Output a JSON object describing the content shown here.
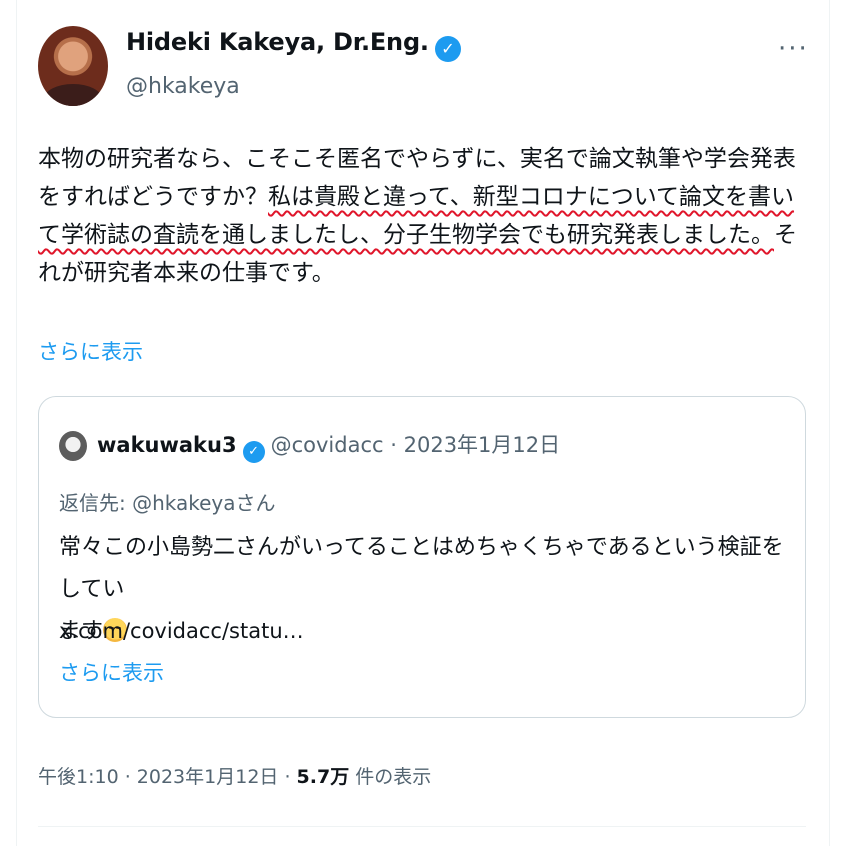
{
  "author": {
    "name": "Hideki Kakeya, Dr.Eng.",
    "handle": "@hkakeya",
    "verified_icon": "verified-badge-icon"
  },
  "menu": {
    "more_label": "···"
  },
  "tweet": {
    "line1": "本物の研究者なら、こそこそ匿名でやらずに、実名で論文執筆や学会発表",
    "line2_plain": "をすればどうですか？",
    "line2_underlined": "私は貴殿と違って、新型コロナについて論文を書い",
    "line3_underlined": "て学術誌の査読を通しましたし、分子生物学会でも研究発表しました。",
    "line3_plain": "そ",
    "line4": "れが研究者本来の仕事です。",
    "show_more": "さらに表示"
  },
  "quote": {
    "name": "wakuwaku3",
    "handle": "@covidacc",
    "sep": "·",
    "date": "2023年1月12日",
    "replying_to": "返信先: @hkakeyaさん",
    "text_line1": "常々この小島勢二さんがいってることはめちゃくちゃであるという検証をしてい",
    "text_line2": "ます",
    "link": "x.com/covidacc/statu…",
    "show_more": "さらに表示"
  },
  "footer": {
    "time_date": "午後1:10 · 2023年1月12日 · ",
    "views_count": "5.7万",
    "views_label": " 件の表示"
  },
  "colors": {
    "accent": "#1d9bf0",
    "underline": "#e0162b",
    "secondary_text": "#536471"
  }
}
